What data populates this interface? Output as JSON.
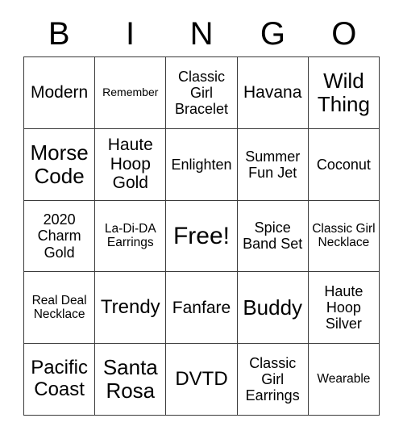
{
  "card": {
    "title": "BINGO",
    "headers": [
      "B",
      "I",
      "N",
      "G",
      "O"
    ],
    "rows": [
      [
        {
          "label": "Modern",
          "size": "l"
        },
        {
          "label": "Remember",
          "size": "xs"
        },
        {
          "label": "Classic Girl Bracelet",
          "size": "m"
        },
        {
          "label": "Havana",
          "size": "l"
        },
        {
          "label": "Wild Thing",
          "size": "xxl"
        }
      ],
      [
        {
          "label": "Morse Code",
          "size": "xxl"
        },
        {
          "label": "Haute Hoop Gold",
          "size": "l"
        },
        {
          "label": "Enlighten",
          "size": "m"
        },
        {
          "label": "Summer Fun Jet",
          "size": "m"
        },
        {
          "label": "Coconut",
          "size": "m"
        }
      ],
      [
        {
          "label": "2020 Charm Gold",
          "size": "m"
        },
        {
          "label": "La-Di-DA Earrings",
          "size": "s"
        },
        {
          "label": "Free!",
          "size": "free"
        },
        {
          "label": "Spice Band Set",
          "size": "m"
        },
        {
          "label": "Classic Girl Necklace",
          "size": "s"
        }
      ],
      [
        {
          "label": "Real Deal Necklace",
          "size": "s"
        },
        {
          "label": "Trendy",
          "size": "xl"
        },
        {
          "label": "Fanfare",
          "size": "l"
        },
        {
          "label": "Buddy",
          "size": "xxl"
        },
        {
          "label": "Haute Hoop Silver",
          "size": "m"
        }
      ],
      [
        {
          "label": "Pacific Coast",
          "size": "xl"
        },
        {
          "label": "Santa Rosa",
          "size": "xxl"
        },
        {
          "label": "DVTD",
          "size": "xl"
        },
        {
          "label": "Classic Girl Earrings",
          "size": "m"
        },
        {
          "label": "Wearable",
          "size": "s"
        }
      ]
    ],
    "colors": {
      "background": "#ffffff",
      "text": "#000000",
      "border": "#3a3a3a"
    }
  }
}
